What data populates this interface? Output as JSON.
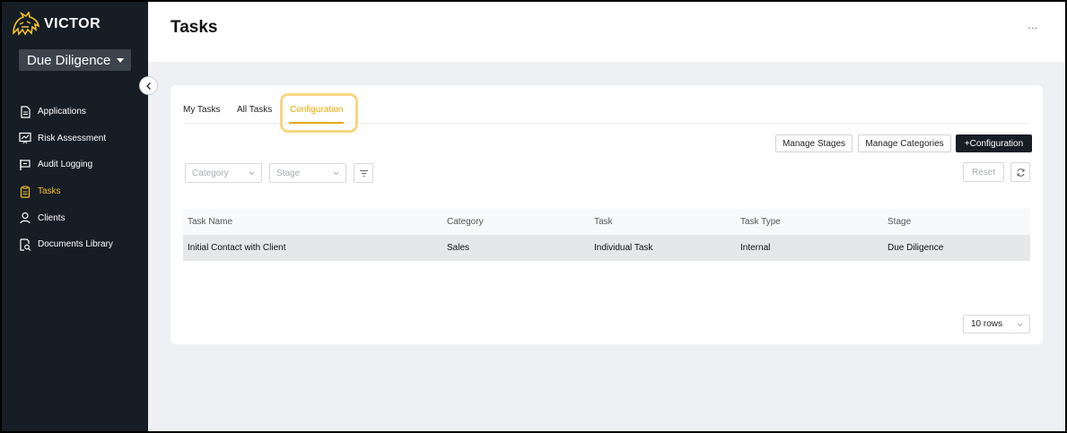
{
  "brand": {
    "name": "VICTOR",
    "accent": "#f4c02c"
  },
  "sidebar": {
    "workspace": "Due Diligence",
    "collapse_icon": "chevron-left-icon",
    "items": [
      {
        "label": "Applications",
        "icon": "document-icon",
        "active": false
      },
      {
        "label": "Risk Assessment",
        "icon": "chart-icon",
        "active": false
      },
      {
        "label": "Audit Logging",
        "icon": "audit-icon",
        "active": false
      },
      {
        "label": "Tasks",
        "icon": "clipboard-icon",
        "active": true
      },
      {
        "label": "Clients",
        "icon": "user-icon",
        "active": false
      },
      {
        "label": "Documents Library",
        "icon": "document-search-icon",
        "active": false
      }
    ]
  },
  "header": {
    "title": "Tasks",
    "more": "..."
  },
  "tabs": [
    {
      "label": "My Tasks",
      "active": false
    },
    {
      "label": "All Tasks",
      "active": false
    },
    {
      "label": "Configuration",
      "active": true
    }
  ],
  "toolbar": {
    "manage_stages": "Manage Stages",
    "manage_categories": "Manage Categories",
    "add_configuration": "+Configuration"
  },
  "filters": {
    "category_placeholder": "Category",
    "stage_placeholder": "Stage",
    "filter_icon": "filter-icon",
    "reset": "Reset",
    "refresh_icon": "refresh-icon"
  },
  "table": {
    "columns": [
      "Task Name",
      "Category",
      "Task",
      "Task Type",
      "Stage"
    ],
    "rows": [
      [
        "Initial Contact with Client",
        "Sales",
        "Individual Task",
        "Internal",
        "Due Diligence"
      ]
    ]
  },
  "pagination": {
    "rows_per_page": "10 rows"
  }
}
